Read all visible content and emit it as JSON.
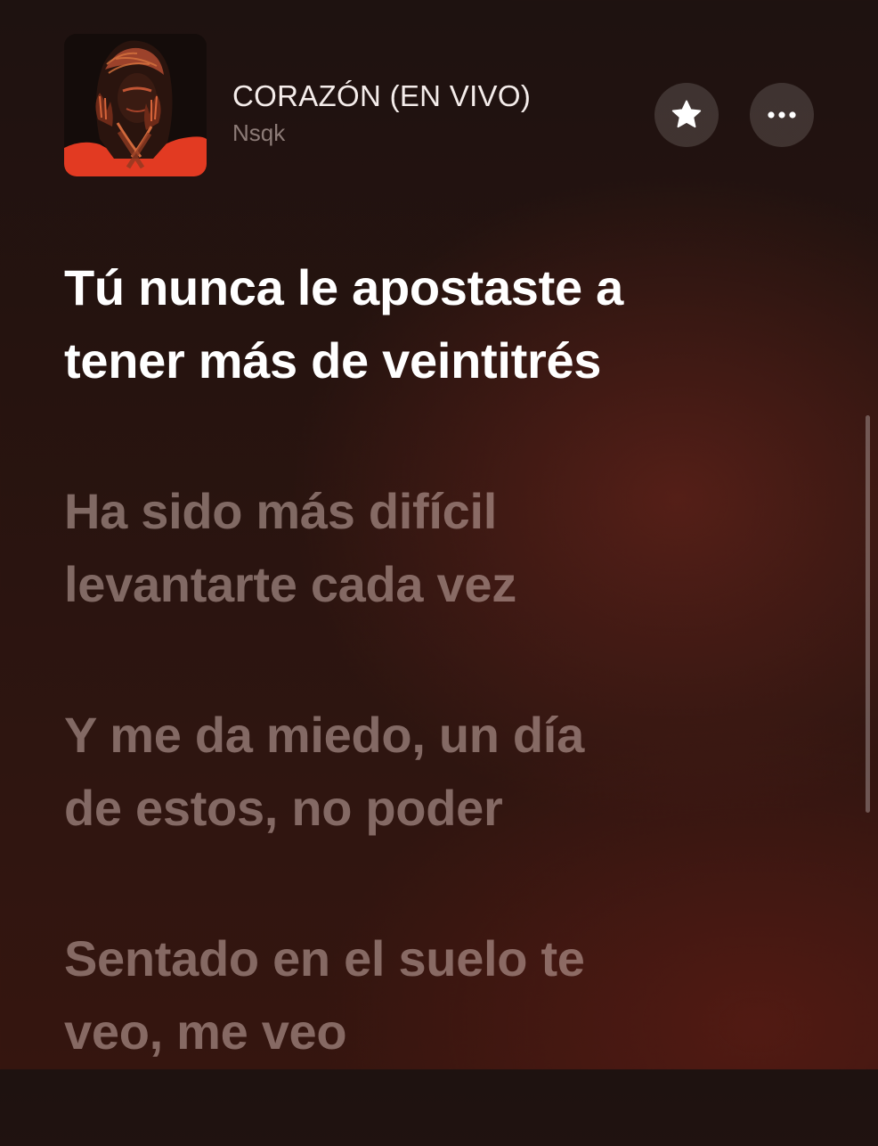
{
  "track": {
    "title": "CORAZÓN (EN VIVO)",
    "artist": "Nsqk"
  },
  "controls": {
    "favorite_icon": "star-icon",
    "more_icon": "ellipsis-icon"
  },
  "lyrics": [
    {
      "text": "Tú nunca le apostaste a\ntener más de veintitrés",
      "state": "active"
    },
    {
      "text": "Ha sido más difícil\nlevantarte cada vez",
      "state": "inactive"
    },
    {
      "text": "Y me da miedo, un día\nde estos, no poder",
      "state": "inactive"
    },
    {
      "text": "Sentado en el suelo te\nveo, me veo",
      "state": "inactive"
    }
  ],
  "colors": {
    "artwork_red": "#e23a22",
    "active_lyric": "#ffffff",
    "inactive_lyric": "#d7beb8"
  }
}
